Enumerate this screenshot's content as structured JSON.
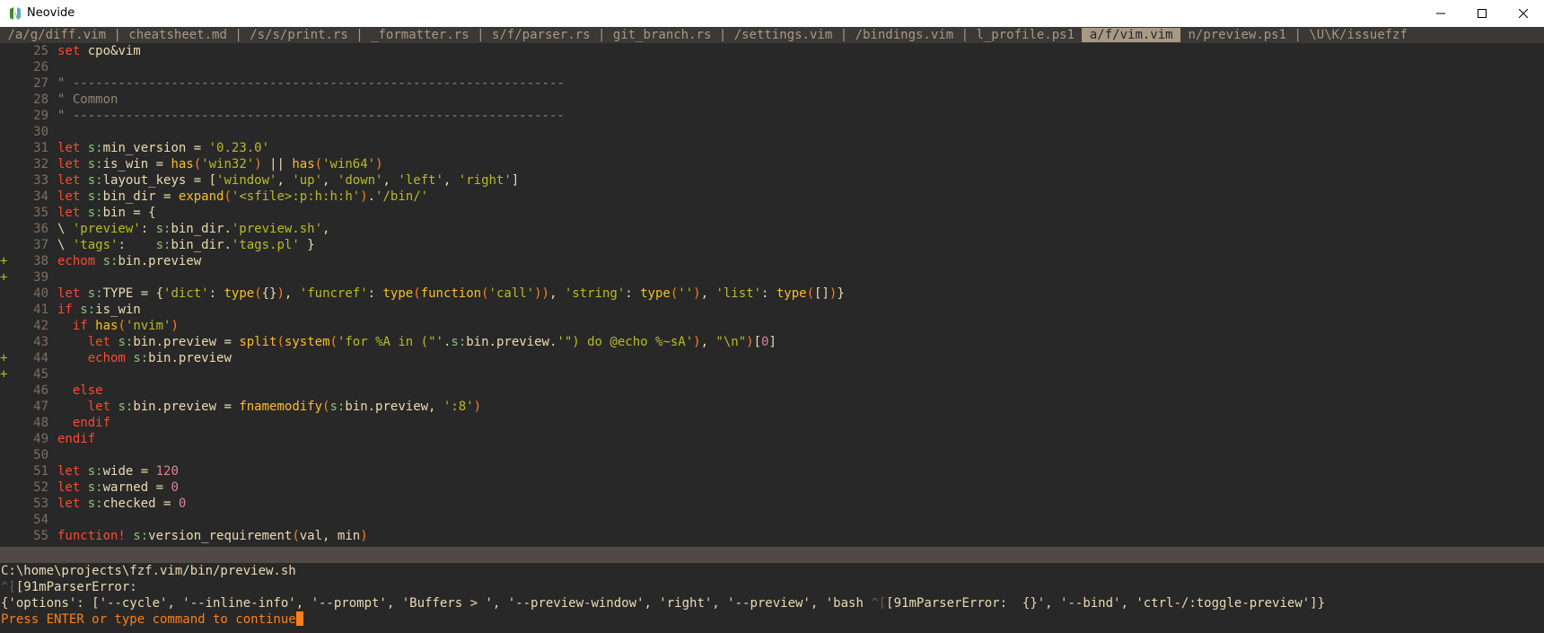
{
  "window": {
    "title": "Neovide"
  },
  "colors": {
    "background": "#282828",
    "tabline": "#3c3836",
    "selected_tab": "#a89984",
    "statusline": "#504945",
    "prompt": "#fe8019",
    "sign": "#b8bb26"
  },
  "tabs": [
    {
      "label": "/a/g/diff.vim",
      "selected": false
    },
    {
      "label": "cheatsheet.md",
      "selected": false
    },
    {
      "label": "/s/s/print.rs",
      "selected": false
    },
    {
      "label": "_formatter.rs",
      "selected": false
    },
    {
      "label": "s/f/parser.rs",
      "selected": false
    },
    {
      "label": "git_branch.rs",
      "selected": false
    },
    {
      "label": "/settings.vim",
      "selected": false
    },
    {
      "label": "/bindings.vim",
      "selected": false
    },
    {
      "label": "l_profile.ps1",
      "selected": false
    },
    {
      "label": "a/f/vim.vim",
      "selected": true
    },
    {
      "label": "n/preview.ps1",
      "selected": false
    },
    {
      "label": "\\U\\K/issuefzf",
      "selected": false
    }
  ],
  "lines": [
    {
      "n": "25",
      "sign": "",
      "tokens": [
        [
          "kw",
          "set"
        ],
        [
          "ident",
          " cpo&vim"
        ]
      ]
    },
    {
      "n": "26",
      "sign": "",
      "tokens": []
    },
    {
      "n": "27",
      "sign": "",
      "tokens": [
        [
          "cmt",
          "\" -----------------------------------------------------------------"
        ]
      ]
    },
    {
      "n": "28",
      "sign": "",
      "tokens": [
        [
          "cmt",
          "\" Common"
        ]
      ]
    },
    {
      "n": "29",
      "sign": "",
      "tokens": [
        [
          "cmt",
          "\" -----------------------------------------------------------------"
        ]
      ]
    },
    {
      "n": "30",
      "sign": "",
      "tokens": []
    },
    {
      "n": "31",
      "sign": "",
      "tokens": [
        [
          "kw",
          "let"
        ],
        [
          "ident",
          " "
        ],
        [
          "scope",
          "s:"
        ],
        [
          "ident",
          "min_version = "
        ],
        [
          "str",
          "'0.23.0'"
        ]
      ]
    },
    {
      "n": "32",
      "sign": "",
      "tokens": [
        [
          "kw",
          "let"
        ],
        [
          "ident",
          " "
        ],
        [
          "scope",
          "s:"
        ],
        [
          "ident",
          "is_win = "
        ],
        [
          "fn",
          "has"
        ],
        [
          "paren",
          "("
        ],
        [
          "str",
          "'win32'"
        ],
        [
          "paren",
          ")"
        ],
        [
          "ident",
          " || "
        ],
        [
          "fn",
          "has"
        ],
        [
          "paren",
          "("
        ],
        [
          "str",
          "'win64'"
        ],
        [
          "paren",
          ")"
        ]
      ]
    },
    {
      "n": "33",
      "sign": "",
      "tokens": [
        [
          "kw",
          "let"
        ],
        [
          "ident",
          " "
        ],
        [
          "scope",
          "s:"
        ],
        [
          "ident",
          "layout_keys = ["
        ],
        [
          "str",
          "'window'"
        ],
        [
          "ident",
          ", "
        ],
        [
          "str",
          "'up'"
        ],
        [
          "ident",
          ", "
        ],
        [
          "str",
          "'down'"
        ],
        [
          "ident",
          ", "
        ],
        [
          "str",
          "'left'"
        ],
        [
          "ident",
          ", "
        ],
        [
          "str",
          "'right'"
        ],
        [
          "ident",
          "]"
        ]
      ]
    },
    {
      "n": "34",
      "sign": "",
      "tokens": [
        [
          "kw",
          "let"
        ],
        [
          "ident",
          " "
        ],
        [
          "scope",
          "s:"
        ],
        [
          "ident",
          "bin_dir = "
        ],
        [
          "fn",
          "expand"
        ],
        [
          "paren",
          "("
        ],
        [
          "str",
          "'<sfile>:p:h:h:h'"
        ],
        [
          "paren",
          ")"
        ],
        [
          "ident",
          "."
        ],
        [
          "str",
          "'/bin/'"
        ]
      ]
    },
    {
      "n": "35",
      "sign": "",
      "tokens": [
        [
          "kw",
          "let"
        ],
        [
          "ident",
          " "
        ],
        [
          "scope",
          "s:"
        ],
        [
          "ident",
          "bin = {"
        ]
      ]
    },
    {
      "n": "36",
      "sign": "",
      "tokens": [
        [
          "ident",
          "\\ "
        ],
        [
          "str",
          "'preview'"
        ],
        [
          "ident",
          ": "
        ],
        [
          "scope",
          "s:"
        ],
        [
          "ident",
          "bin_dir."
        ],
        [
          "str",
          "'preview.sh'"
        ],
        [
          "ident",
          ","
        ]
      ]
    },
    {
      "n": "37",
      "sign": "",
      "tokens": [
        [
          "ident",
          "\\ "
        ],
        [
          "str",
          "'tags'"
        ],
        [
          "ident",
          ":    "
        ],
        [
          "scope",
          "s:"
        ],
        [
          "ident",
          "bin_dir."
        ],
        [
          "str",
          "'tags.pl'"
        ],
        [
          "ident",
          " }"
        ]
      ]
    },
    {
      "n": "38",
      "sign": "+",
      "tokens": [
        [
          "kw",
          "echom"
        ],
        [
          "ident",
          " "
        ],
        [
          "scope",
          "s:"
        ],
        [
          "ident",
          "bin.preview"
        ]
      ]
    },
    {
      "n": "39",
      "sign": "+",
      "tokens": []
    },
    {
      "n": "40",
      "sign": "",
      "tokens": [
        [
          "kw",
          "let"
        ],
        [
          "ident",
          " "
        ],
        [
          "scope",
          "s:"
        ],
        [
          "ident",
          "TYPE = {"
        ],
        [
          "str",
          "'dict'"
        ],
        [
          "ident",
          ": "
        ],
        [
          "fn",
          "type"
        ],
        [
          "paren",
          "("
        ],
        [
          "ident",
          "{}"
        ],
        [
          "paren",
          ")"
        ],
        [
          "ident",
          ", "
        ],
        [
          "str",
          "'funcref'"
        ],
        [
          "ident",
          ": "
        ],
        [
          "fn",
          "type"
        ],
        [
          "paren",
          "("
        ],
        [
          "fn",
          "function"
        ],
        [
          "paren",
          "("
        ],
        [
          "str",
          "'call'"
        ],
        [
          "paren",
          "))"
        ],
        [
          "ident",
          ", "
        ],
        [
          "str",
          "'string'"
        ],
        [
          "ident",
          ": "
        ],
        [
          "fn",
          "type"
        ],
        [
          "paren",
          "("
        ],
        [
          "str",
          "''"
        ],
        [
          "paren",
          ")"
        ],
        [
          "ident",
          ", "
        ],
        [
          "str",
          "'list'"
        ],
        [
          "ident",
          ": "
        ],
        [
          "fn",
          "type"
        ],
        [
          "paren",
          "("
        ],
        [
          "ident",
          "[]"
        ],
        [
          "paren",
          ")"
        ],
        [
          "ident",
          "}"
        ]
      ]
    },
    {
      "n": "41",
      "sign": "",
      "tokens": [
        [
          "kw",
          "if"
        ],
        [
          "ident",
          " "
        ],
        [
          "scope",
          "s:"
        ],
        [
          "ident",
          "is_win"
        ]
      ]
    },
    {
      "n": "42",
      "sign": "",
      "tokens": [
        [
          "ident",
          "  "
        ],
        [
          "kw",
          "if"
        ],
        [
          "ident",
          " "
        ],
        [
          "fn",
          "has"
        ],
        [
          "paren",
          "("
        ],
        [
          "str",
          "'nvim'"
        ],
        [
          "paren",
          ")"
        ]
      ]
    },
    {
      "n": "43",
      "sign": "",
      "tokens": [
        [
          "ident",
          "    "
        ],
        [
          "kw",
          "let"
        ],
        [
          "ident",
          " "
        ],
        [
          "scope",
          "s:"
        ],
        [
          "ident",
          "bin.preview = "
        ],
        [
          "fn",
          "split"
        ],
        [
          "paren",
          "("
        ],
        [
          "fn",
          "system"
        ],
        [
          "paren",
          "("
        ],
        [
          "str",
          "'for %A in (\"'"
        ],
        [
          "ident",
          "."
        ],
        [
          "scope",
          "s:"
        ],
        [
          "ident",
          "bin.preview."
        ],
        [
          "str",
          "'\") do @echo %~sA'"
        ],
        [
          "paren",
          ")"
        ],
        [
          "ident",
          ", "
        ],
        [
          "str",
          "\"\\n\""
        ],
        [
          "paren",
          ")"
        ],
        [
          "ident",
          "["
        ],
        [
          "num",
          "0"
        ],
        [
          "ident",
          "]"
        ]
      ]
    },
    {
      "n": "44",
      "sign": "+",
      "tokens": [
        [
          "ident",
          "    "
        ],
        [
          "kw",
          "echom"
        ],
        [
          "ident",
          " "
        ],
        [
          "scope",
          "s:"
        ],
        [
          "ident",
          "bin.preview"
        ]
      ]
    },
    {
      "n": "45",
      "sign": "+",
      "tokens": []
    },
    {
      "n": "46",
      "sign": "",
      "tokens": [
        [
          "ident",
          "  "
        ],
        [
          "kw",
          "else"
        ]
      ]
    },
    {
      "n": "47",
      "sign": "",
      "tokens": [
        [
          "ident",
          "    "
        ],
        [
          "kw",
          "let"
        ],
        [
          "ident",
          " "
        ],
        [
          "scope",
          "s:"
        ],
        [
          "ident",
          "bin.preview = "
        ],
        [
          "fn",
          "fnamemodify"
        ],
        [
          "paren",
          "("
        ],
        [
          "scope",
          "s:"
        ],
        [
          "ident",
          "bin.preview, "
        ],
        [
          "str",
          "':8'"
        ],
        [
          "paren",
          ")"
        ]
      ]
    },
    {
      "n": "48",
      "sign": "",
      "tokens": [
        [
          "ident",
          "  "
        ],
        [
          "kw",
          "endif"
        ]
      ]
    },
    {
      "n": "49",
      "sign": "",
      "tokens": [
        [
          "kw",
          "endif"
        ]
      ]
    },
    {
      "n": "50",
      "sign": "",
      "tokens": []
    },
    {
      "n": "51",
      "sign": "",
      "tokens": [
        [
          "kw",
          "let"
        ],
        [
          "ident",
          " "
        ],
        [
          "scope",
          "s:"
        ],
        [
          "ident",
          "wide = "
        ],
        [
          "num",
          "120"
        ]
      ]
    },
    {
      "n": "52",
      "sign": "",
      "tokens": [
        [
          "kw",
          "let"
        ],
        [
          "ident",
          " "
        ],
        [
          "scope",
          "s:"
        ],
        [
          "ident",
          "warned = "
        ],
        [
          "num",
          "0"
        ]
      ]
    },
    {
      "n": "53",
      "sign": "",
      "tokens": [
        [
          "kw",
          "let"
        ],
        [
          "ident",
          " "
        ],
        [
          "scope",
          "s:"
        ],
        [
          "ident",
          "checked = "
        ],
        [
          "num",
          "0"
        ]
      ]
    },
    {
      "n": "54",
      "sign": "",
      "tokens": []
    },
    {
      "n": "55",
      "sign": "",
      "tokens": [
        [
          "kw",
          "function!"
        ],
        [
          "ident",
          " "
        ],
        [
          "scope",
          "s:"
        ],
        [
          "ident",
          "version_requirement"
        ],
        [
          "paren",
          "("
        ],
        [
          "ident",
          "val, min"
        ],
        [
          "paren",
          ")"
        ]
      ]
    }
  ],
  "messages": {
    "path": "C:\\home\\projects\\fzf.vim/bin/preview.sh",
    "error_prefix": "^[",
    "error_text": "[91mParserError:",
    "options_a": "{'options': ['--cycle', '--inline-info', '--prompt', 'Buffers > ', '--preview-window', 'right', '--preview', 'bash ",
    "options_ctrl": "^[",
    "options_b": "[91mParserError:  {}', '--bind', 'ctrl-/:toggle-preview']}",
    "prompt": "Press ENTER or type command to continue"
  }
}
